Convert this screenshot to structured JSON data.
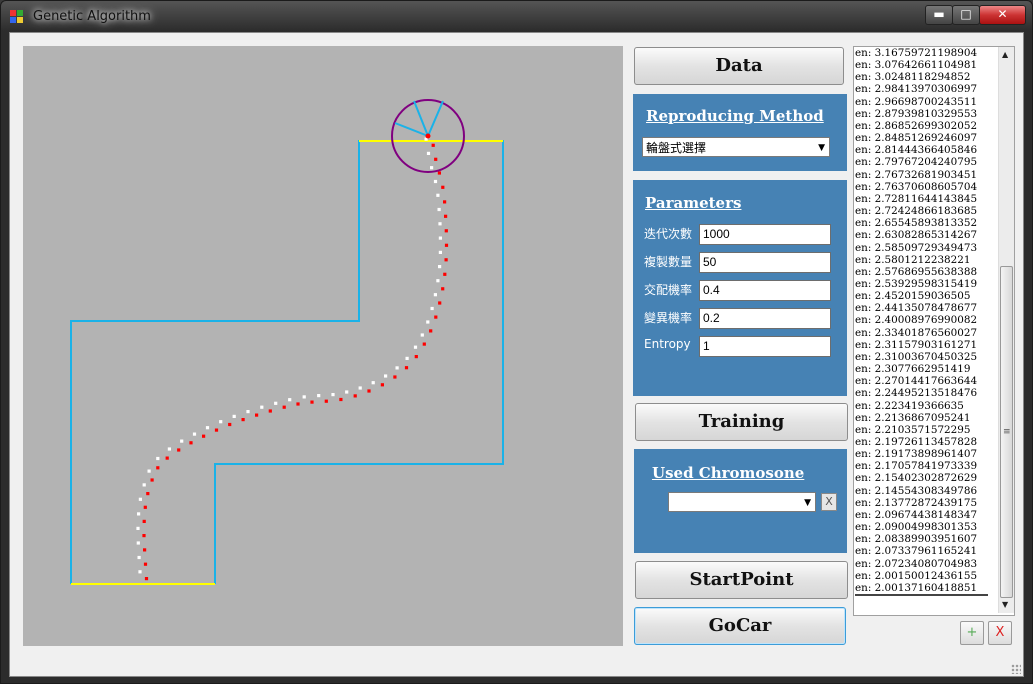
{
  "window": {
    "title": "Genetic Algorithm"
  },
  "controls": {
    "minimize": "▬",
    "maximize": "□",
    "close": "✕"
  },
  "buttons": {
    "data": "Data",
    "training": "Training",
    "startpoint": "StartPoint",
    "gocar": "GoCar"
  },
  "reproducing": {
    "title": "Reproducing Method",
    "selected": "輪盤式選擇"
  },
  "parameters": {
    "title": "Parameters",
    "fields": [
      {
        "label": "迭代次數",
        "value": "1000"
      },
      {
        "label": "複製數量",
        "value": "50"
      },
      {
        "label": "交配機率",
        "value": "0.4"
      },
      {
        "label": "變異機率",
        "value": "0.2"
      },
      {
        "label": "Entropy",
        "value": "1"
      }
    ]
  },
  "chromosome": {
    "title": "Used Chromosone",
    "selected": "",
    "clear_label": "X"
  },
  "entropy_log": [
    "en: 3.16759721198904",
    "en: 3.07642661104981",
    "en: 3.0248118294852",
    "en: 2.98413970306997",
    "en: 2.96698700243511",
    "en: 2.87939810329553",
    "en: 2.86852699302052",
    "en: 2.84851269246097",
    "en: 2.81444366405846",
    "en: 2.79767204240795",
    "en: 2.76732681903451",
    "en: 2.76370608605704",
    "en: 2.72811644143845",
    "en: 2.72424866183685",
    "en: 2.65545893813352",
    "en: 2.63082865314267",
    "en: 2.58509729349473",
    "en: 2.5801212238221",
    "en: 2.57686955638388",
    "en: 2.53929598315419",
    "en: 2.4520159036505",
    "en: 2.44135078478677",
    "en: 2.40008976990082",
    "en: 2.33401876560027",
    "en: 2.31157903161271",
    "en: 2.31003670450325",
    "en: 2.3077662951419",
    "en: 2.27014417663644",
    "en: 2.24495213518476",
    "en: 2.223419366635",
    "en: 2.2136867095241",
    "en: 2.2103571572295",
    "en: 2.19726113457828",
    "en: 2.19173898961407",
    "en: 2.17057841973339",
    "en: 2.15402302872629",
    "en: 2.14554308349786",
    "en: 2.13772872439175",
    "en: 2.09674438148347",
    "en: 2.09004998301353",
    "en: 2.08389903951607",
    "en: 2.07337961165241",
    "en: 2.07234080704983",
    "en: 2.00150012436155",
    "en: 2.00137160418851"
  ],
  "list_buttons": {
    "add": "+",
    "remove": "X"
  },
  "colors": {
    "track": "#1ab2e8",
    "line": "#ffff00",
    "car": "#800080",
    "path_a": "#ff0000",
    "path_b": "#ffffff",
    "panel": "#4682b4",
    "canvas": "#b3b3b3"
  }
}
